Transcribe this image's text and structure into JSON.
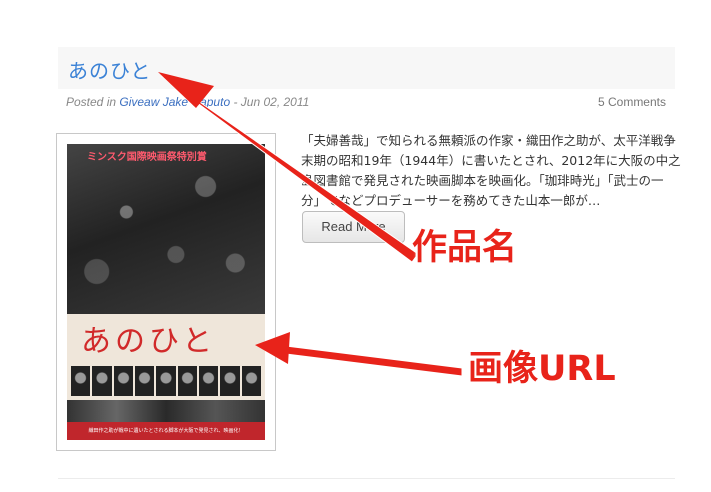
{
  "post": {
    "title": "あのひと",
    "meta_prefix": "Posted in ",
    "category": "Giveaw",
    "author": "Jake Caputo",
    "date_sep": " - ",
    "date": "Jun 02, 2011",
    "comments": "5 Comments",
    "excerpt": "「夫婦善哉」で知られる無頼派の作家・織田作之助が、太平洋戦争末期の昭和19年（1944年）に書いたとされ、2012年に大阪の中之島図書館で発見された映画脚本を映画化。「珈琲時光」「武士の一分」でなどプロデューサーを務めてきた山本一郎が…",
    "read_more": "Read More"
  },
  "poster": {
    "award": "ミンスク国際映画祭特別賞",
    "handwritten_title": "あのひと",
    "bottom_text": "織田作之助が戦中に遺いたとされる脚本が大阪で発見され、映画化！"
  },
  "annotations": {
    "title_callout": "作品名",
    "image_callout": "画像URL",
    "arrow_color": "#e8231a"
  }
}
